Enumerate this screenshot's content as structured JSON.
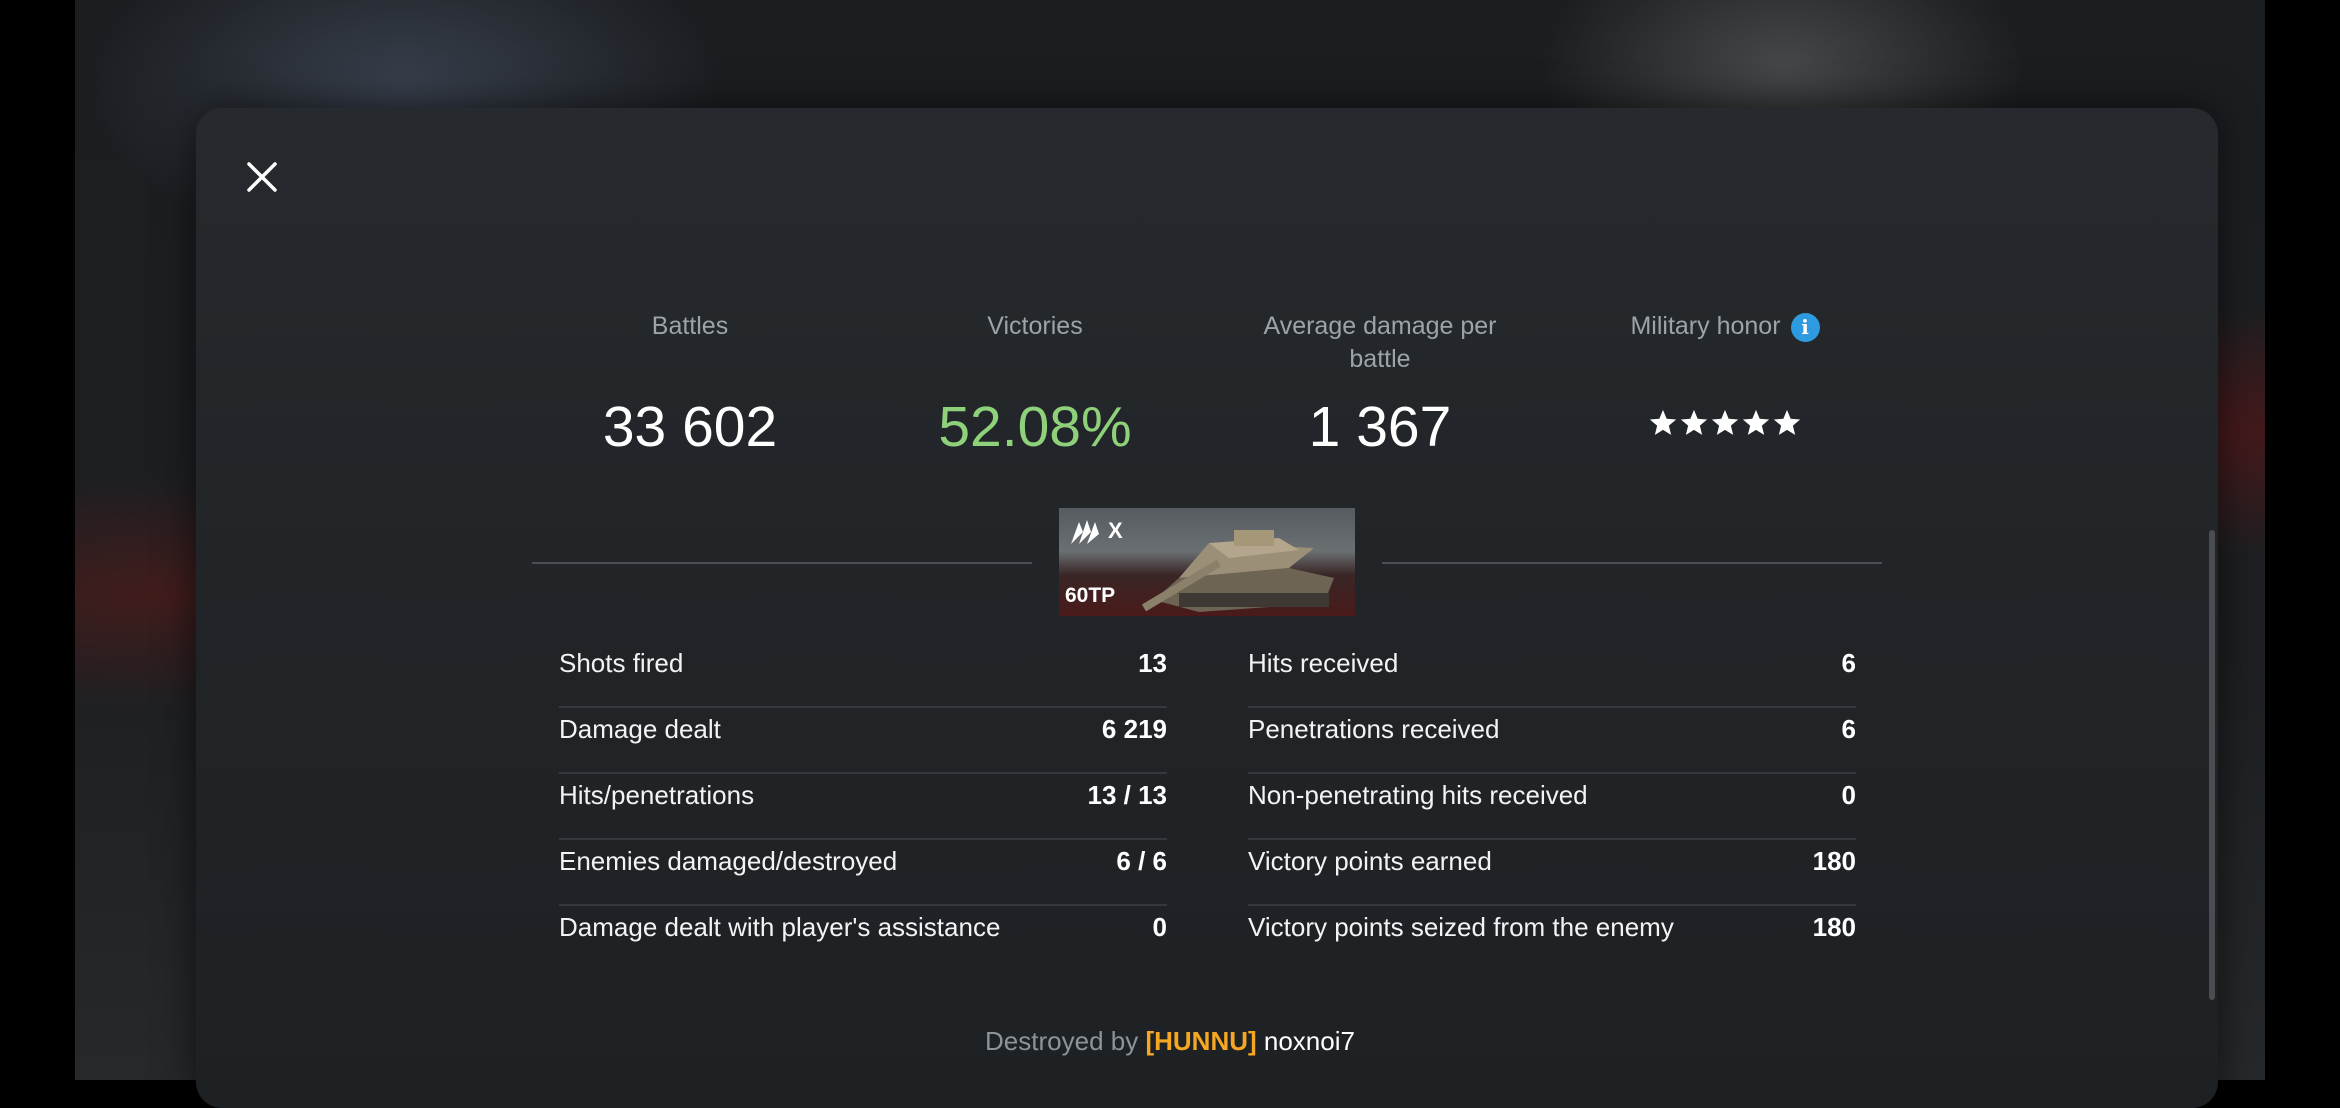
{
  "summary": {
    "battles_label": "Battles",
    "battles_value": "33 602",
    "victories_label": "Victories",
    "victories_value": "52.08%",
    "avg_damage_label": "Average damage per battle",
    "avg_damage_value": "1 367",
    "honor_label": "Military honor",
    "honor_stars": 5,
    "honor_stars_text": "★★★★★"
  },
  "vehicle": {
    "tier": "X",
    "name": "60TP",
    "nation_icon": "poland-nation-icon"
  },
  "left_stats": [
    {
      "label": "Shots fired",
      "value": "13"
    },
    {
      "label": "Damage dealt",
      "value": "6 219"
    },
    {
      "label": "Hits/penetrations",
      "value": "13 / 13"
    },
    {
      "label": "Enemies damaged/destroyed",
      "value": "6 / 6"
    },
    {
      "label": "Damage dealt with player's assistance",
      "value": "0"
    }
  ],
  "right_stats": [
    {
      "label": "Hits received",
      "value": "6"
    },
    {
      "label": "Penetrations received",
      "value": "6"
    },
    {
      "label": "Non-penetrating hits received",
      "value": "0"
    },
    {
      "label": "Victory points earned",
      "value": "180"
    },
    {
      "label": "Victory points seized from the enemy",
      "value": "180"
    }
  ],
  "footer": {
    "prefix": "Destroyed by",
    "clan": "[HUNNU]",
    "player": "noxnoi7"
  },
  "colors": {
    "victories_green": "#8fd17a",
    "clan_orange": "#f5a623",
    "info_blue": "#2e9be0"
  }
}
